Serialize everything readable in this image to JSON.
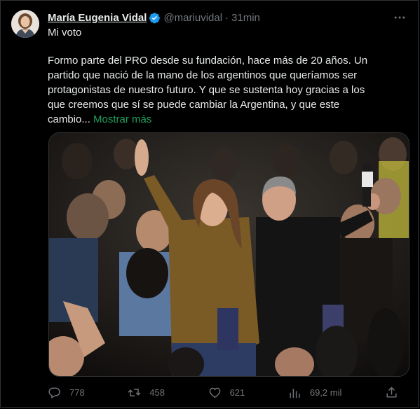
{
  "tweet": {
    "author_name": "María Eugenia Vidal",
    "handle": "@mariuvidal",
    "separator": "·",
    "time": "31min",
    "line1": "Mi voto",
    "body": "Formo parte del PRO desde su fundación, hace más de 20 años. Un partido que nació de la mano de los argentinos que queríamos ser protagonistas de nuestro futuro. Y que se sustenta hoy gracias a los que creemos que sí se puede cambiar la Argentina, y que este cambio...",
    "show_more": "Mostrar más"
  },
  "actions": {
    "replies": "778",
    "retweets": "458",
    "likes": "621",
    "views": "69,2 mil"
  },
  "colors": {
    "background": "#000000",
    "text": "#e7e9ea",
    "muted": "#71767b",
    "verified": "#1d9bf0",
    "show_more": "#1fa05b"
  },
  "icons": [
    "verified-badge-icon",
    "more-options-icon",
    "reply-icon",
    "retweet-icon",
    "like-icon",
    "views-icon",
    "share-icon"
  ]
}
